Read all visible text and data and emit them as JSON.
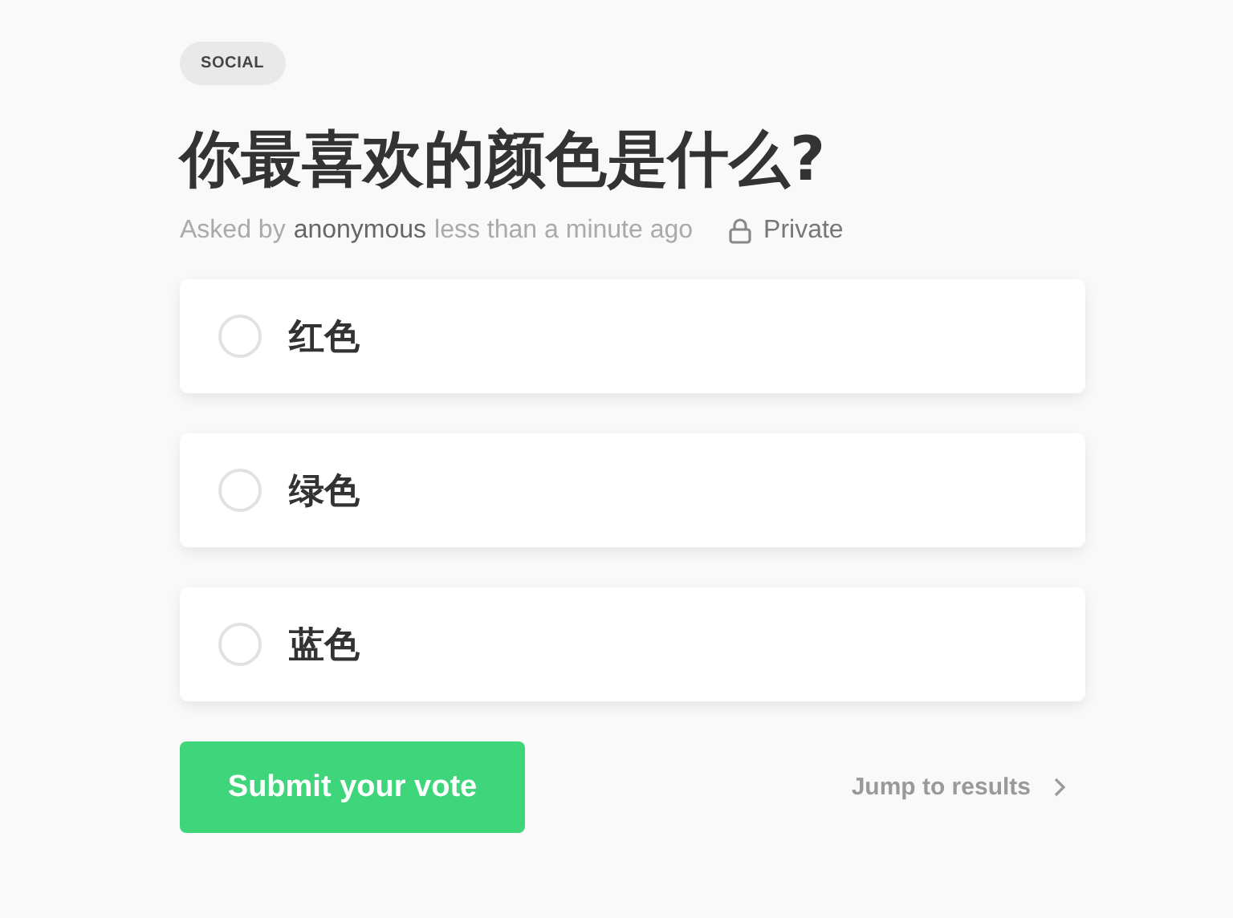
{
  "category": "SOCIAL",
  "question": "你最喜欢的颜色是什么?",
  "meta": {
    "asked_by": "Asked by",
    "author": "anonymous",
    "time": "less than a minute ago",
    "visibility": "Private"
  },
  "options": [
    {
      "label": "红色",
      "selected": false
    },
    {
      "label": "绿色",
      "selected": false
    },
    {
      "label": "蓝色",
      "selected": false
    }
  ],
  "submit_button": "Submit your vote",
  "results_link": "Jump to results"
}
